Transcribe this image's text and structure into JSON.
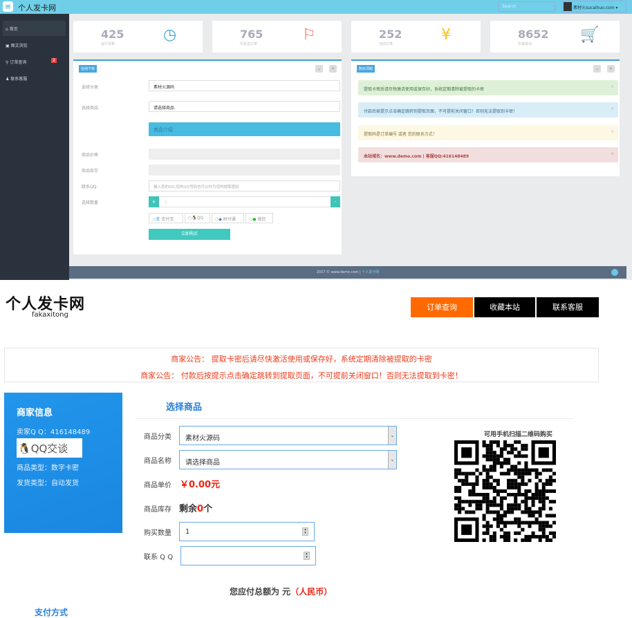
{
  "admin": {
    "title": "个人发卡网",
    "search_placeholder": "Search",
    "user": "素材火sucaihuo.com",
    "sidebar": [
      {
        "label": "首页",
        "icon": "home-icon"
      },
      {
        "label": "图文浏览",
        "icon": "image-icon"
      },
      {
        "label": "订单查询",
        "icon": "search-icon",
        "badge": "2"
      },
      {
        "label": "联系客服",
        "icon": "user-icon"
      }
    ],
    "stats": [
      {
        "value": "425",
        "label": "运行天数",
        "icon": "clock-icon",
        "color": "#3fa7d6"
      },
      {
        "value": "765",
        "label": "历史总订单",
        "icon": "flag-icon",
        "color": "#f4635a"
      },
      {
        "value": "252",
        "label": "当前订单",
        "icon": "yen-icon",
        "color": "#f5c518"
      },
      {
        "value": "8652",
        "label": "交易成功",
        "icon": "cart-icon",
        "color": "#a35de8"
      }
    ],
    "order_panel": {
      "tag": "在线下单",
      "category_label": "选择分类",
      "category_value": "素材火源码",
      "product_label": "选择商品",
      "product_value": "请选择商品",
      "intro": "商品介绍",
      "price_label": "商品价格",
      "stock_label": "商品库存",
      "qq_label": "联系QQ",
      "qq_placeholder": "输入您的QQ,您的QQ号码也可以作为您的提取密码",
      "qty_label": "选择数量",
      "qty_value": "1",
      "plus": "+",
      "minus": "-",
      "pay_methods": [
        "支付宝",
        "QQ",
        "财付通",
        "微信"
      ],
      "buy": "立即购买"
    },
    "notice_panel": {
      "tag": "购买须知",
      "alerts": [
        "提取卡密后请尽快激活使用或保存好，系统定期清除被提取的卡密",
        "付款后按提示点击确定跳转到提取页面，不可提前关闭窗口！否则无法提取到卡密！",
        "提取码是订单编号 或者 您的联系方式！",
        "本站域名：www.demo.com | 客服QQ:416148489"
      ]
    },
    "footer": {
      "text": "2017 © www.demo.com | ",
      "link": "个人发卡网"
    }
  },
  "shop": {
    "logo": "个人发卡网",
    "logo_sub": "fakaxitong",
    "nav": [
      "订单查询",
      "收藏本站",
      "联系客服"
    ],
    "notices": [
      "商家公告： 提取卡密后请尽快激活使用或保存好，系统定期清除被提取的卡密",
      "商家公告： 付款后按提示点击确定跳转到提取页面，不可提前关闭窗口！否则无法提取到卡密！"
    ],
    "merchant": {
      "title": "商家信息",
      "qq": "卖家Q Q：416148489",
      "qq_button": "QQ交谈",
      "type": "商品类型：数字卡密",
      "delivery": "发货类型：自动发货"
    },
    "select_title": "选择商品",
    "form": {
      "category_label": "商品分类",
      "category_value": "素材火源码",
      "name_label": "商品名称",
      "name_value": "请选择商品",
      "price_label": "商品单价",
      "price": "￥0.00元",
      "stock_label": "商品库存",
      "stock_prefix": "剩余",
      "stock_count": "0",
      "stock_suffix": "个",
      "qty_label": "购买数量",
      "qty_value": "1",
      "qq_label": "联系 Q Q",
      "qq_value": ""
    },
    "qr_title": "可用手机扫描二维码购买",
    "total_prefix": "您应付总额为 元",
    "total_suffix": "（人民币）",
    "pay_title": "支付方式"
  }
}
